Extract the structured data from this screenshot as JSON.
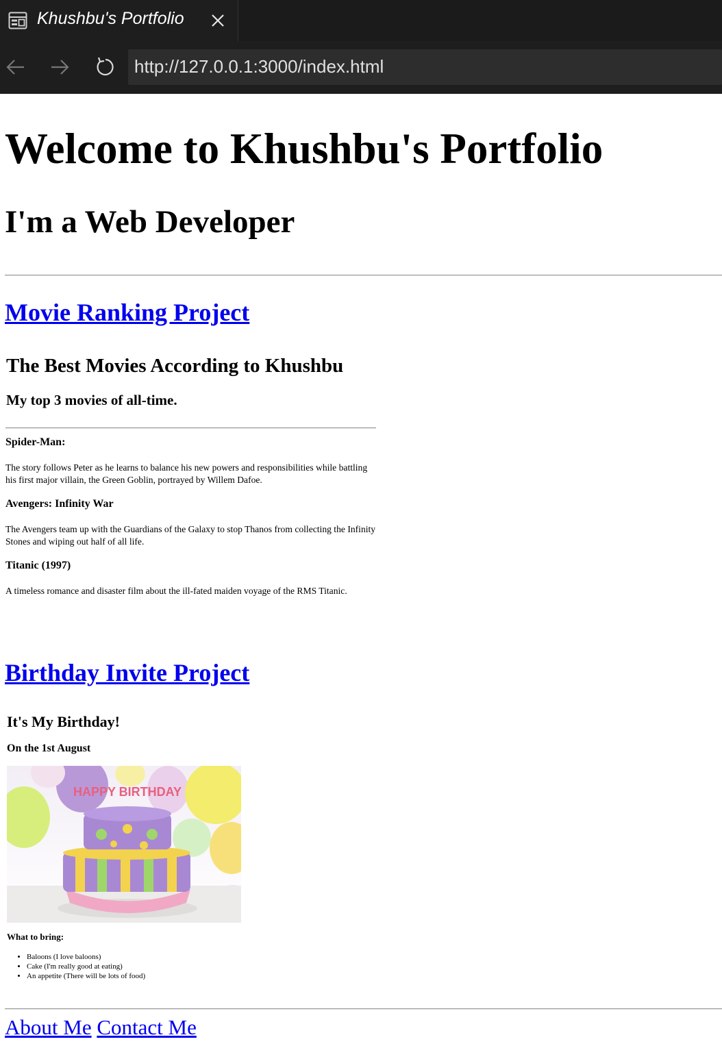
{
  "browser": {
    "tab_title": "Khushbu's Portfolio",
    "url": "http://127.0.0.1:3000/index.html",
    "icons": {
      "tab": "page-layout-icon",
      "close": "close-icon",
      "back": "back-arrow-icon",
      "forward": "forward-arrow-icon",
      "reload": "reload-icon"
    }
  },
  "page": {
    "title": "Welcome to Khushbu's Portfolio",
    "subtitle": "I'm a Web Developer",
    "movie_project": {
      "link_label": "Movie Ranking Project",
      "heading": "The Best Movies According to Khushbu",
      "subheading": "My top 3 movies of all-time.",
      "movies": [
        {
          "title": "Spider-Man:",
          "description": "The story follows Peter as he learns to balance his new powers and responsibilities while battling his first major villain, the Green Goblin, portrayed by Willem Dafoe."
        },
        {
          "title": "Avengers: Infinity War",
          "description": "The Avengers team up with the Guardians of the Galaxy to stop Thanos from collecting the Infinity Stones and wiping out half of all life."
        },
        {
          "title": "Titanic (1997)",
          "description": "A timeless romance and disaster film about the ill-fated maiden voyage of the RMS Titanic."
        }
      ]
    },
    "birthday_project": {
      "link_label": "Birthday Invite Project",
      "heading": "It's My Birthday!",
      "date": "On the 1st August",
      "cake_text": "HAPPY BIRTHDAY",
      "bring_heading": "What to bring:",
      "bring_items": [
        "Baloons (I love baloons)",
        "Cake (I'm really good at eating)",
        "An appetite (There will be lots of food)"
      ]
    },
    "footer": {
      "about_label": "About Me",
      "contact_label": "Contact Me"
    },
    "colors": {
      "link": "#0000ee",
      "chrome_bg": "#1e1e1e",
      "urlbar_bg": "#2d2d2d"
    }
  }
}
